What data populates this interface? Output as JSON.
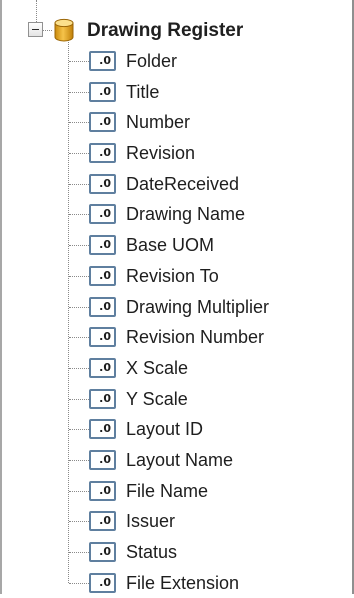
{
  "tree": {
    "root": {
      "label": "Drawing Register",
      "icon": "database-icon",
      "expanded": true
    },
    "fields": [
      {
        "label": "Folder",
        "icon": ".0"
      },
      {
        "label": "Title",
        "icon": ".0"
      },
      {
        "label": "Number",
        "icon": ".0"
      },
      {
        "label": "Revision",
        "icon": ".0"
      },
      {
        "label": "DateReceived",
        "icon": ".0"
      },
      {
        "label": "Drawing Name",
        "icon": ".0"
      },
      {
        "label": "Base UOM",
        "icon": ".0"
      },
      {
        "label": "Revision To",
        "icon": ".0"
      },
      {
        "label": "Drawing Multiplier",
        "icon": ".0"
      },
      {
        "label": "Revision Number",
        "icon": ".0"
      },
      {
        "label": "X Scale",
        "icon": ".0"
      },
      {
        "label": "Y Scale",
        "icon": ".0"
      },
      {
        "label": "Layout ID",
        "icon": ".0"
      },
      {
        "label": "Layout Name",
        "icon": ".0"
      },
      {
        "label": "File Name",
        "icon": ".0"
      },
      {
        "label": "Issuer",
        "icon": ".0"
      },
      {
        "label": "Status",
        "icon": ".0"
      },
      {
        "label": "File Extension",
        "icon": ".0"
      }
    ]
  },
  "colors": {
    "field_icon_border": "#5f7f9f",
    "db_icon_gold": "#e8a317"
  }
}
